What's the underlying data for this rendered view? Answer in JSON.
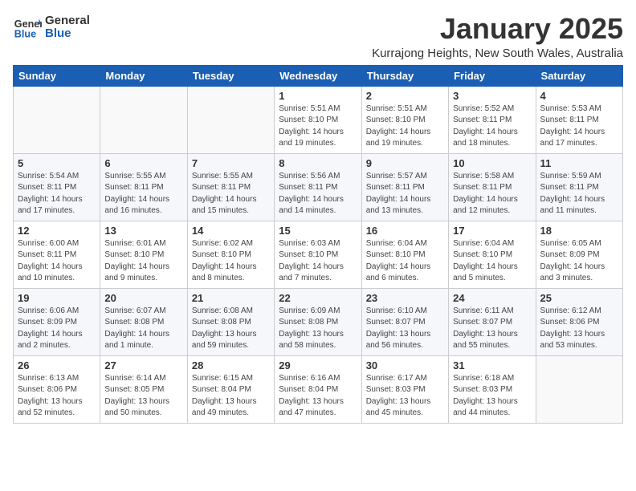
{
  "header": {
    "logo": {
      "text1": "General",
      "text2": "Blue"
    },
    "title": "January 2025",
    "location": "Kurrajong Heights, New South Wales, Australia"
  },
  "weekdays": [
    "Sunday",
    "Monday",
    "Tuesday",
    "Wednesday",
    "Thursday",
    "Friday",
    "Saturday"
  ],
  "weeks": [
    [
      {
        "day": "",
        "info": ""
      },
      {
        "day": "",
        "info": ""
      },
      {
        "day": "",
        "info": ""
      },
      {
        "day": "1",
        "info": "Sunrise: 5:51 AM\nSunset: 8:10 PM\nDaylight: 14 hours\nand 19 minutes."
      },
      {
        "day": "2",
        "info": "Sunrise: 5:51 AM\nSunset: 8:10 PM\nDaylight: 14 hours\nand 19 minutes."
      },
      {
        "day": "3",
        "info": "Sunrise: 5:52 AM\nSunset: 8:11 PM\nDaylight: 14 hours\nand 18 minutes."
      },
      {
        "day": "4",
        "info": "Sunrise: 5:53 AM\nSunset: 8:11 PM\nDaylight: 14 hours\nand 17 minutes."
      }
    ],
    [
      {
        "day": "5",
        "info": "Sunrise: 5:54 AM\nSunset: 8:11 PM\nDaylight: 14 hours\nand 17 minutes."
      },
      {
        "day": "6",
        "info": "Sunrise: 5:55 AM\nSunset: 8:11 PM\nDaylight: 14 hours\nand 16 minutes."
      },
      {
        "day": "7",
        "info": "Sunrise: 5:55 AM\nSunset: 8:11 PM\nDaylight: 14 hours\nand 15 minutes."
      },
      {
        "day": "8",
        "info": "Sunrise: 5:56 AM\nSunset: 8:11 PM\nDaylight: 14 hours\nand 14 minutes."
      },
      {
        "day": "9",
        "info": "Sunrise: 5:57 AM\nSunset: 8:11 PM\nDaylight: 14 hours\nand 13 minutes."
      },
      {
        "day": "10",
        "info": "Sunrise: 5:58 AM\nSunset: 8:11 PM\nDaylight: 14 hours\nand 12 minutes."
      },
      {
        "day": "11",
        "info": "Sunrise: 5:59 AM\nSunset: 8:11 PM\nDaylight: 14 hours\nand 11 minutes."
      }
    ],
    [
      {
        "day": "12",
        "info": "Sunrise: 6:00 AM\nSunset: 8:11 PM\nDaylight: 14 hours\nand 10 minutes."
      },
      {
        "day": "13",
        "info": "Sunrise: 6:01 AM\nSunset: 8:10 PM\nDaylight: 14 hours\nand 9 minutes."
      },
      {
        "day": "14",
        "info": "Sunrise: 6:02 AM\nSunset: 8:10 PM\nDaylight: 14 hours\nand 8 minutes."
      },
      {
        "day": "15",
        "info": "Sunrise: 6:03 AM\nSunset: 8:10 PM\nDaylight: 14 hours\nand 7 minutes."
      },
      {
        "day": "16",
        "info": "Sunrise: 6:04 AM\nSunset: 8:10 PM\nDaylight: 14 hours\nand 6 minutes."
      },
      {
        "day": "17",
        "info": "Sunrise: 6:04 AM\nSunset: 8:10 PM\nDaylight: 14 hours\nand 5 minutes."
      },
      {
        "day": "18",
        "info": "Sunrise: 6:05 AM\nSunset: 8:09 PM\nDaylight: 14 hours\nand 3 minutes."
      }
    ],
    [
      {
        "day": "19",
        "info": "Sunrise: 6:06 AM\nSunset: 8:09 PM\nDaylight: 14 hours\nand 2 minutes."
      },
      {
        "day": "20",
        "info": "Sunrise: 6:07 AM\nSunset: 8:08 PM\nDaylight: 14 hours\nand 1 minute."
      },
      {
        "day": "21",
        "info": "Sunrise: 6:08 AM\nSunset: 8:08 PM\nDaylight: 13 hours\nand 59 minutes."
      },
      {
        "day": "22",
        "info": "Sunrise: 6:09 AM\nSunset: 8:08 PM\nDaylight: 13 hours\nand 58 minutes."
      },
      {
        "day": "23",
        "info": "Sunrise: 6:10 AM\nSunset: 8:07 PM\nDaylight: 13 hours\nand 56 minutes."
      },
      {
        "day": "24",
        "info": "Sunrise: 6:11 AM\nSunset: 8:07 PM\nDaylight: 13 hours\nand 55 minutes."
      },
      {
        "day": "25",
        "info": "Sunrise: 6:12 AM\nSunset: 8:06 PM\nDaylight: 13 hours\nand 53 minutes."
      }
    ],
    [
      {
        "day": "26",
        "info": "Sunrise: 6:13 AM\nSunset: 8:06 PM\nDaylight: 13 hours\nand 52 minutes."
      },
      {
        "day": "27",
        "info": "Sunrise: 6:14 AM\nSunset: 8:05 PM\nDaylight: 13 hours\nand 50 minutes."
      },
      {
        "day": "28",
        "info": "Sunrise: 6:15 AM\nSunset: 8:04 PM\nDaylight: 13 hours\nand 49 minutes."
      },
      {
        "day": "29",
        "info": "Sunrise: 6:16 AM\nSunset: 8:04 PM\nDaylight: 13 hours\nand 47 minutes."
      },
      {
        "day": "30",
        "info": "Sunrise: 6:17 AM\nSunset: 8:03 PM\nDaylight: 13 hours\nand 45 minutes."
      },
      {
        "day": "31",
        "info": "Sunrise: 6:18 AM\nSunset: 8:03 PM\nDaylight: 13 hours\nand 44 minutes."
      },
      {
        "day": "",
        "info": ""
      }
    ]
  ]
}
